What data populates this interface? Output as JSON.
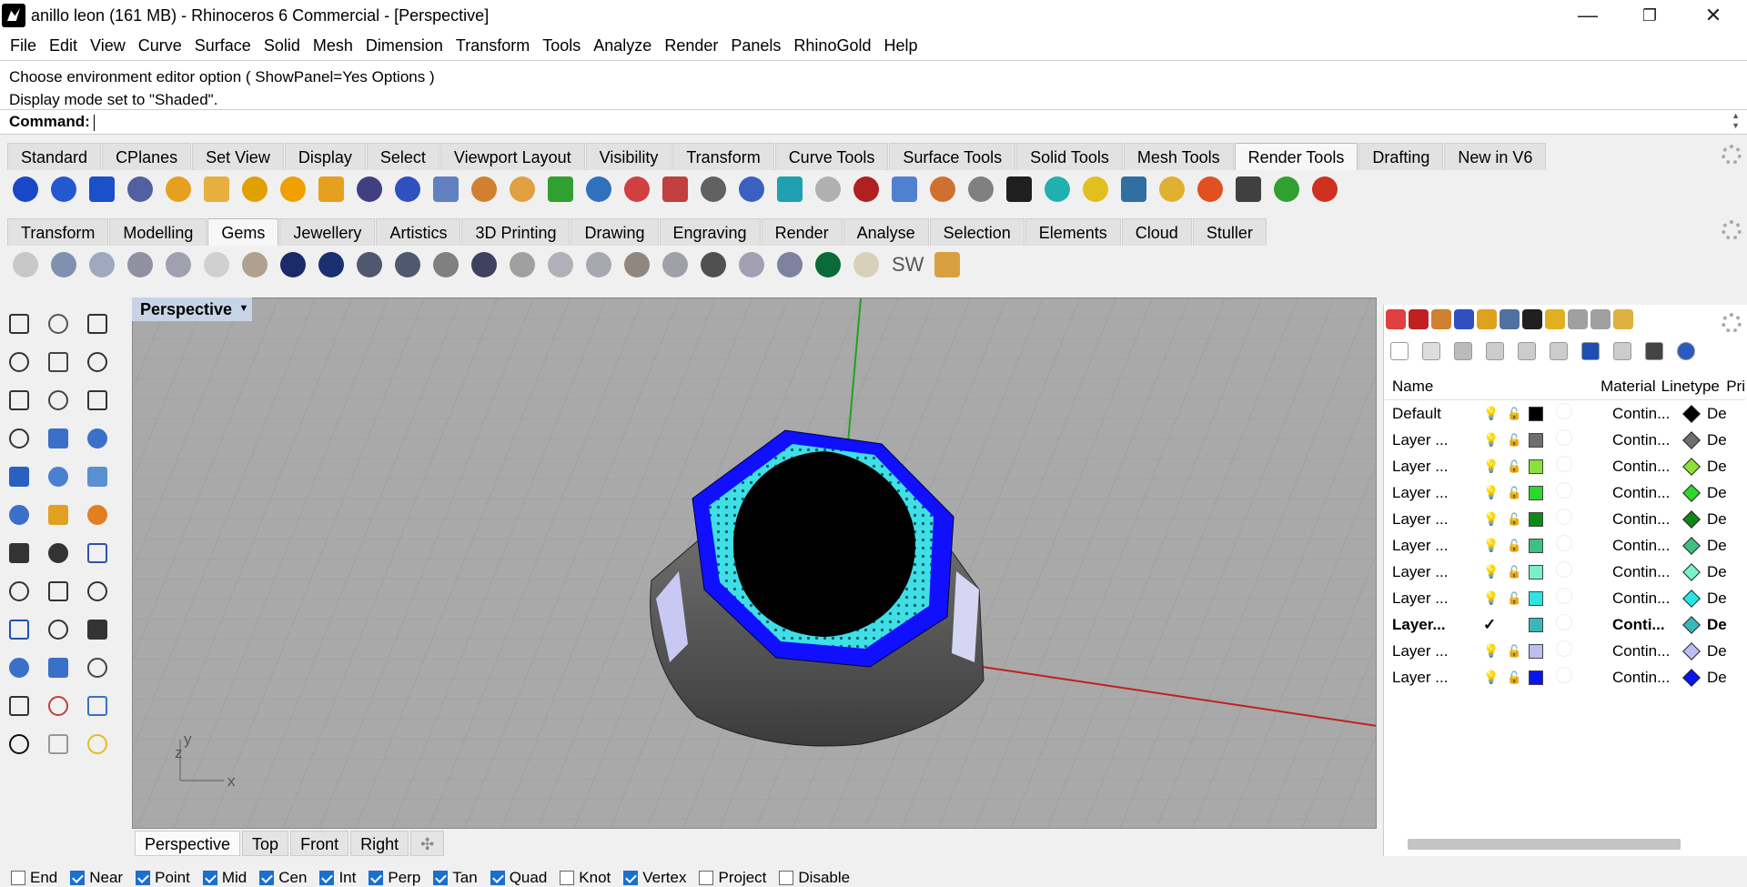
{
  "titlebar": {
    "title": "anillo leon (161 MB) - Rhinoceros 6 Commercial - [Perspective]",
    "minimize": "—",
    "restore": "❐",
    "close": "✕"
  },
  "menu": [
    "File",
    "Edit",
    "View",
    "Curve",
    "Surface",
    "Solid",
    "Mesh",
    "Dimension",
    "Transform",
    "Tools",
    "Analyze",
    "Render",
    "Panels",
    "RhinoGold",
    "Help"
  ],
  "command": {
    "history": [
      "Choose environment editor option ( ShowPanel=Yes  Options )",
      "Display mode set to \"Shaded\"."
    ],
    "prompt": "Command:"
  },
  "toolbar_tabs": [
    "Standard",
    "CPlanes",
    "Set View",
    "Display",
    "Select",
    "Viewport Layout",
    "Visibility",
    "Transform",
    "Curve Tools",
    "Surface Tools",
    "Solid Tools",
    "Mesh Tools",
    "Render Tools",
    "Drafting",
    "New in V6"
  ],
  "toolbar_active": "Render Tools",
  "rhinogold_tabs": [
    "Transform",
    "Modelling",
    "Gems",
    "Jewellery",
    "Artistics",
    "3D Printing",
    "Drawing",
    "Engraving",
    "Render",
    "Analyse",
    "Selection",
    "Elements",
    "Cloud",
    "Stuller"
  ],
  "rhinogold_active": "Gems",
  "rhinogold_sw": "SW",
  "viewport": {
    "label": "Perspective",
    "axis_y": "y",
    "axis_z": "z",
    "axis_x": "x"
  },
  "viewport_tabs": [
    "Perspective",
    "Top",
    "Front",
    "Right"
  ],
  "osnaps": [
    {
      "label": "End",
      "on": false
    },
    {
      "label": "Near",
      "on": true
    },
    {
      "label": "Point",
      "on": true
    },
    {
      "label": "Mid",
      "on": true
    },
    {
      "label": "Cen",
      "on": true
    },
    {
      "label": "Int",
      "on": true
    },
    {
      "label": "Perp",
      "on": true
    },
    {
      "label": "Tan",
      "on": true
    },
    {
      "label": "Quad",
      "on": true
    },
    {
      "label": "Knot",
      "on": false
    },
    {
      "label": "Vertex",
      "on": true
    },
    {
      "label": "Project",
      "on": false
    },
    {
      "label": "Disable",
      "on": false
    }
  ],
  "layers": {
    "headers": {
      "name": "Name",
      "material": "Material",
      "linetype": "Linetype",
      "print": "Pri"
    },
    "rows": [
      {
        "name": "Default",
        "color": "#000000",
        "linetype": "Contin...",
        "print": "De",
        "current": false
      },
      {
        "name": "Layer ...",
        "color": "#6e6e6e",
        "linetype": "Contin...",
        "print": "De",
        "current": false
      },
      {
        "name": "Layer ...",
        "color": "#8be03a",
        "linetype": "Contin...",
        "print": "De",
        "current": false
      },
      {
        "name": "Layer ...",
        "color": "#2ed62e",
        "linetype": "Contin...",
        "print": "De",
        "current": false
      },
      {
        "name": "Layer ...",
        "color": "#0b8a14",
        "linetype": "Contin...",
        "print": "De",
        "current": false
      },
      {
        "name": "Layer ...",
        "color": "#3fbf83",
        "linetype": "Contin...",
        "print": "De",
        "current": false
      },
      {
        "name": "Layer ...",
        "color": "#79f0c6",
        "linetype": "Contin...",
        "print": "De",
        "current": false
      },
      {
        "name": "Layer ...",
        "color": "#2de4e4",
        "linetype": "Contin...",
        "print": "De",
        "current": false
      },
      {
        "name": "Layer...",
        "color": "#39b8b8",
        "linetype": "Conti...",
        "print": "De",
        "current": true,
        "check": "✓"
      },
      {
        "name": "Layer ...",
        "color": "#bdbdf2",
        "linetype": "Contin...",
        "print": "De",
        "current": false
      },
      {
        "name": "Layer ...",
        "color": "#0a14f0",
        "linetype": "Contin...",
        "print": "De",
        "current": false
      }
    ]
  },
  "colors": {
    "accent": "#1a6fd1",
    "viewport_bg": "#a8a8a8",
    "ring_blue": "#1010ff",
    "gem_cyan": "#3ee0e6"
  }
}
